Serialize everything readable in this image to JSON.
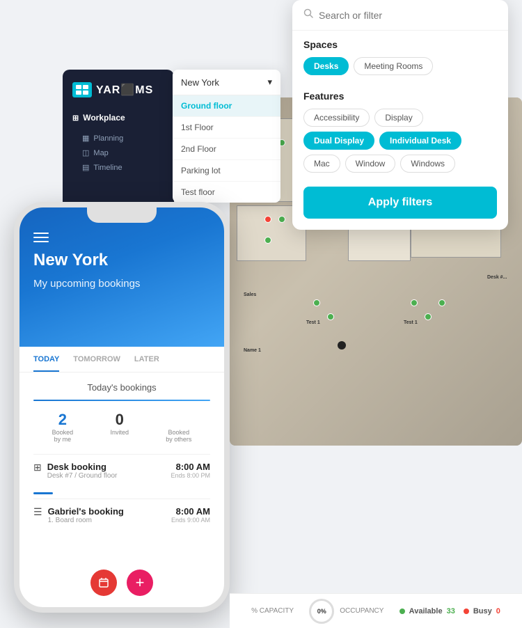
{
  "app": {
    "name": "YAROMS",
    "logo_highlight": "O"
  },
  "sidebar": {
    "section_label": "Workplace",
    "items": [
      {
        "label": "Planning",
        "icon": "▦"
      },
      {
        "label": "Map",
        "icon": "◫"
      },
      {
        "label": "Timeline",
        "icon": "▤"
      }
    ]
  },
  "location_dropdown": {
    "selected": "New York",
    "floors": [
      {
        "label": "Ground floor",
        "active": true
      },
      {
        "label": "1st Floor",
        "active": false
      },
      {
        "label": "2nd Floor",
        "active": false
      },
      {
        "label": "Parking lot",
        "active": false
      },
      {
        "label": "Test floor",
        "active": false
      }
    ]
  },
  "filter_panel": {
    "search_placeholder": "Search or filter",
    "spaces_label": "Spaces",
    "spaces_chips": [
      {
        "label": "Desks",
        "active": true
      },
      {
        "label": "Meeting Rooms",
        "active": false
      }
    ],
    "features_label": "Features",
    "features_chips": [
      {
        "label": "Accessibility",
        "active": false
      },
      {
        "label": "Display",
        "active": false
      },
      {
        "label": "Dual Display",
        "active": true
      },
      {
        "label": "Individual Desk",
        "active": true
      },
      {
        "label": "Mac",
        "active": false
      },
      {
        "label": "Window",
        "active": false
      },
      {
        "label": "Windows",
        "active": false
      }
    ],
    "apply_button": "Apply filters"
  },
  "mobile": {
    "city": "New York",
    "subtitle": "My upcoming bookings",
    "tabs": [
      {
        "label": "TODAY",
        "active": true
      },
      {
        "label": "TOMORROW",
        "active": false
      },
      {
        "label": "LATER",
        "active": false
      }
    ],
    "bookings_section": "Today's bookings",
    "stats": [
      {
        "num": "2",
        "label": "Booked\nby me",
        "zero": false
      },
      {
        "num": "0",
        "label": "Invited",
        "zero": true
      },
      {
        "num": "",
        "label": "Booked\nby others",
        "zero": false
      }
    ],
    "bookings": [
      {
        "title": "Desk booking",
        "subtitle": "Desk #7 / Ground floor",
        "time": "8:00 AM",
        "ends": "Ends 8:00 PM",
        "icon": "⊞"
      },
      {
        "title": "Gabriel's booking",
        "subtitle": "1. Board room",
        "time": "8:00 AM",
        "ends": "Ends 9:00 AM",
        "icon": "☰"
      }
    ]
  },
  "status_bar": {
    "capacity_label": "% CAPACITY",
    "occupancy_label": "0%\nOCCUPANCY",
    "available_label": "Available",
    "available_count": "33",
    "busy_label": "Busy",
    "busy_count": "0"
  }
}
